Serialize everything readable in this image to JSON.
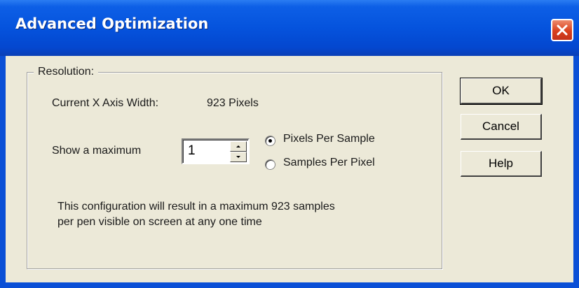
{
  "window": {
    "title": "Advanced Optimization"
  },
  "group": {
    "label": "Resolution:"
  },
  "axis": {
    "label": "Current X Axis Width:",
    "value": "923 Pixels"
  },
  "maximum": {
    "label": "Show a maximum",
    "value": "1"
  },
  "radios": [
    {
      "label": "Pixels Per Sample",
      "checked": true
    },
    {
      "label": "Samples Per Pixel",
      "checked": false
    }
  ],
  "info": {
    "line1": "This configuration will result in a maximum 923 samples",
    "line2": "per pen visible on screen at any one time"
  },
  "buttons": {
    "ok": "OK",
    "cancel": "Cancel",
    "help": "Help"
  },
  "colors": {
    "titlebar": "#0553dd",
    "dialog_bg": "#ece9d8",
    "close_button": "#d9401c"
  },
  "icons": {
    "close": "close-icon",
    "spin_up": "arrow-up-icon",
    "spin_down": "arrow-down-icon"
  }
}
